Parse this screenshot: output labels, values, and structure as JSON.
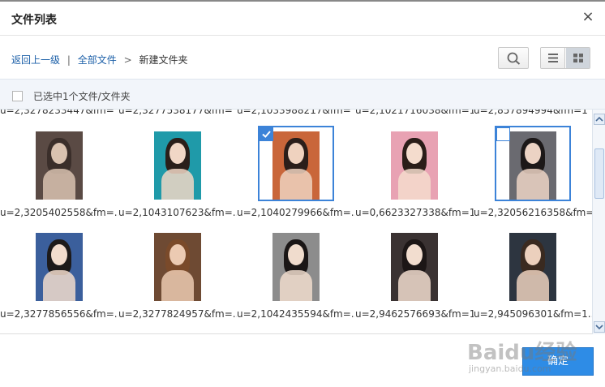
{
  "dialog": {
    "title": "文件列表",
    "close_glyph": "×"
  },
  "breadcrumb": {
    "back": "返回上一级",
    "divider": "|",
    "all_files": "全部文件",
    "arrow": ">",
    "current": "新建文件夹"
  },
  "toolbar": {
    "search_icon": "search-icon",
    "list_view_icon": "list-view-icon",
    "grid_view_icon": "grid-view-icon",
    "active_view": "grid"
  },
  "selection": {
    "status": "已选中1个文件/文件夹"
  },
  "partial_row": [
    "u=2,3278233447&fm=",
    "u=2,3277538177&fm=",
    "u=2,1033988217&fm=",
    "u=2,1021716038&fm=1",
    "u=2,857894994&fm=1"
  ],
  "files": [
    {
      "name": "u=2,3205402558&fm=...",
      "selected": false,
      "hover": false,
      "palette": [
        "#5a4a44",
        "#d9c2b0",
        "#3a2e2a"
      ]
    },
    {
      "name": "u=2,1043107623&fm=...",
      "selected": false,
      "hover": false,
      "palette": [
        "#1f9aa9",
        "#f1d7c6",
        "#2a1f1a"
      ]
    },
    {
      "name": "u=2,1040279966&fm=...",
      "selected": true,
      "hover": false,
      "palette": [
        "#c9663a",
        "#efd2bf",
        "#2a1e1a"
      ]
    },
    {
      "name": "u=0,6623327338&fm=1...",
      "selected": false,
      "hover": false,
      "palette": [
        "#e8a2b3",
        "#f4dccd",
        "#2a1d18"
      ]
    },
    {
      "name": "u=2,32056216358&fm=...",
      "selected": false,
      "hover": true,
      "palette": [
        "#6a6a70",
        "#ecd3c4",
        "#1c1818"
      ]
    },
    {
      "name": "u=2,3277856556&fm=...",
      "selected": false,
      "hover": false,
      "palette": [
        "#3b5f9c",
        "#f2dccd",
        "#1d1a1a"
      ]
    },
    {
      "name": "u=2,3277824957&fm=...",
      "selected": false,
      "hover": false,
      "palette": [
        "#6e4a33",
        "#eccab2",
        "#7a4a2a"
      ]
    },
    {
      "name": "u=2,1042435594&fm=...",
      "selected": false,
      "hover": false,
      "palette": [
        "#8c8c8c",
        "#f0dccd",
        "#1a1616"
      ]
    },
    {
      "name": "u=2,9462576693&fm=1...",
      "selected": false,
      "hover": false,
      "palette": [
        "#3a3232",
        "#f2ddcf",
        "#1c1616"
      ]
    },
    {
      "name": "u=2,945096301&fm=1...",
      "selected": false,
      "hover": false,
      "palette": [
        "#2d3540",
        "#ecd0bd",
        "#3a2a20"
      ]
    }
  ],
  "footer": {
    "ok_label": "确定"
  },
  "watermark": {
    "logo": "Baidu经验",
    "url": "jingyan.baidu.com"
  },
  "colors": {
    "accent": "#3c83d8",
    "button": "#2e8ce6",
    "link": "#1b5fa8",
    "selection_bar_bg": "#f2f5fa"
  }
}
